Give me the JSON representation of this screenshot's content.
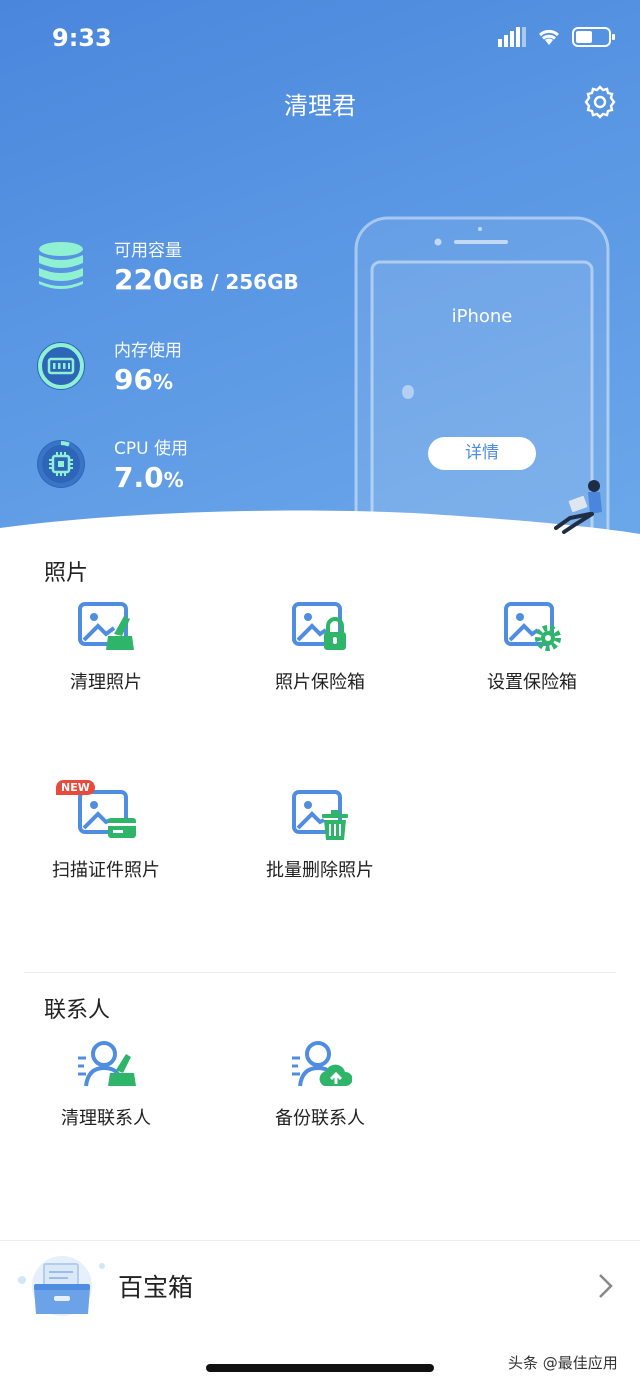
{
  "status": {
    "time": "9:33"
  },
  "header": {
    "title": "清理君"
  },
  "stats": [
    {
      "label": "可用容量",
      "value": "220",
      "unit": "GB / 256GB",
      "icon": "database-icon"
    },
    {
      "label": "内存使用",
      "value": "96",
      "unit": "%",
      "icon": "memory-icon"
    },
    {
      "label": "CPU 使用",
      "value": "7.0",
      "unit": "%",
      "icon": "cpu-icon"
    }
  ],
  "device": {
    "name": "iPhone",
    "detail_label": "详情"
  },
  "photos": {
    "title": "照片",
    "items": [
      {
        "label": "清理照片",
        "icon": "photo-clean-icon"
      },
      {
        "label": "照片保险箱",
        "icon": "photo-lock-icon"
      },
      {
        "label": "设置保险箱",
        "icon": "photo-settings-icon"
      },
      {
        "label": "扫描证件照片",
        "icon": "photo-id-card-icon",
        "badge": "NEW"
      },
      {
        "label": "批量删除照片",
        "icon": "photo-trash-icon"
      }
    ]
  },
  "contacts": {
    "title": "联系人",
    "items": [
      {
        "label": "清理联系人",
        "icon": "contact-clean-icon"
      },
      {
        "label": "备份联系人",
        "icon": "contact-backup-icon"
      }
    ]
  },
  "toolbox": {
    "label": "百宝箱"
  },
  "watermark": "头条 @最佳应用",
  "colors": {
    "accent": "#4f8de0",
    "green": "#2fb56a",
    "hero_start": "#4a86dc",
    "hero_end": "#6ba7ea"
  }
}
